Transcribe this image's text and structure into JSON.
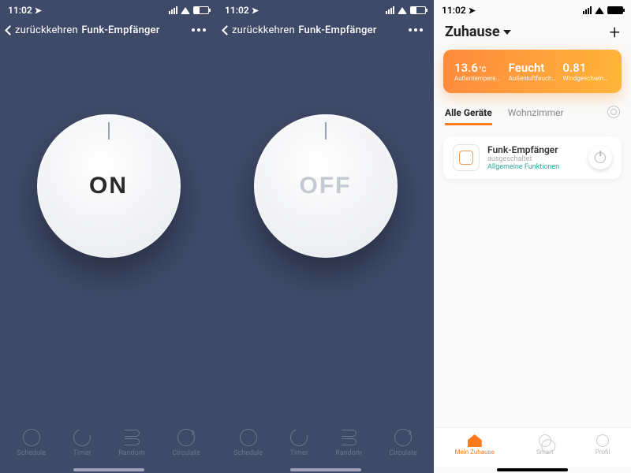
{
  "status": {
    "time": "11:02",
    "loc_glyph": "➤"
  },
  "panels": {
    "on": {
      "back_label": "zurückkehren",
      "title": "Funk-Empfänger",
      "dial_label": "ON",
      "tabs": [
        "Schedule",
        "Timer",
        "Random",
        "Circulate"
      ]
    },
    "off": {
      "back_label": "zurückkehren",
      "title": "Funk-Empfänger",
      "dial_label": "OFF",
      "tabs": [
        "Schedule",
        "Timer",
        "Random",
        "Circulate"
      ]
    }
  },
  "home": {
    "title": "Zuhause",
    "weather": {
      "temp_value": "13.6",
      "temp_unit": "°C",
      "temp_caption": "Außentempera…",
      "hum_value": "Feucht",
      "hum_caption": "Außenluftfeuchtig…",
      "wind_value": "0.81",
      "wind_caption": "Windgeschwindigk…"
    },
    "rooms": {
      "all": "Alle Geräte",
      "living": "Wohnzimmer"
    },
    "device": {
      "name": "Funk-Empfänger",
      "state": "ausgeschaltet",
      "functions": "Allgemeine Funktionen"
    },
    "nav": {
      "home": "Mein Zuhause",
      "smart": "Smart",
      "profile": "Profil"
    }
  }
}
